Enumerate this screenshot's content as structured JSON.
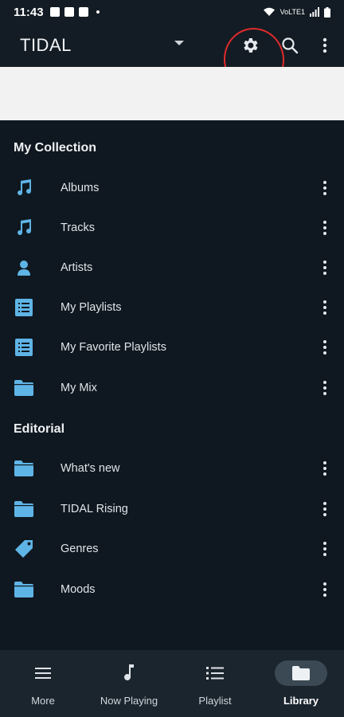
{
  "status_bar": {
    "time": "11:43",
    "network_label": "VoLTE1"
  },
  "app_bar": {
    "title": "TIDAL",
    "icons": [
      "chevron-down-icon",
      "gear-icon",
      "search-icon",
      "more-vert-icon"
    ]
  },
  "annotation": {
    "color": "#e02b2b"
  },
  "sections": [
    {
      "header": "My Collection",
      "items": [
        {
          "label": "Albums",
          "icon": "music-note-icon"
        },
        {
          "label": "Tracks",
          "icon": "music-note-icon"
        },
        {
          "label": "Artists",
          "icon": "person-icon"
        },
        {
          "label": "My Playlists",
          "icon": "playlist-icon"
        },
        {
          "label": "My Favorite Playlists",
          "icon": "playlist-icon"
        },
        {
          "label": "My Mix",
          "icon": "folder-icon"
        }
      ]
    },
    {
      "header": "Editorial",
      "items": [
        {
          "label": "What's new",
          "icon": "folder-icon"
        },
        {
          "label": "TIDAL Rising",
          "icon": "folder-icon"
        },
        {
          "label": "Genres",
          "icon": "tag-icon"
        },
        {
          "label": "Moods",
          "icon": "folder-icon"
        }
      ]
    }
  ],
  "bottom_nav": [
    {
      "label": "More",
      "icon": "menu-icon",
      "active": false
    },
    {
      "label": "Now Playing",
      "icon": "music-note-icon",
      "active": false
    },
    {
      "label": "Playlist",
      "icon": "list-icon",
      "active": false
    },
    {
      "label": "Library",
      "icon": "folder-icon",
      "active": true
    }
  ],
  "colors": {
    "background": "#0f1820",
    "app_bar": "#131c24",
    "accent_icon": "#5fb4e6",
    "banner": "#f2f2f2",
    "bottom_nav": "#1b252e"
  }
}
